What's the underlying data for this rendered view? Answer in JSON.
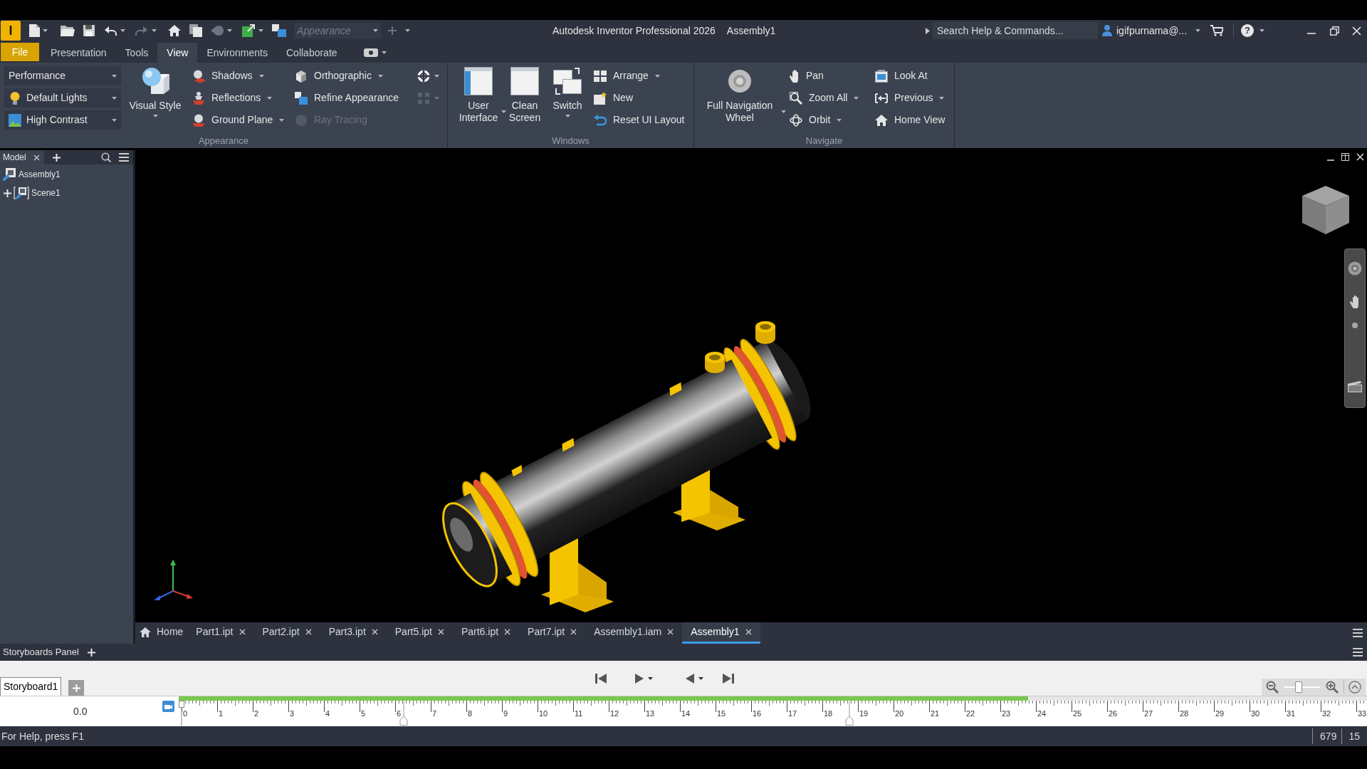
{
  "title_bar": {
    "app_logo": "I",
    "appearance_dropdown": {
      "value": "Appearance",
      "disabled": true
    },
    "title": "Autodesk Inventor Professional 2026",
    "document": "Assembly1",
    "search": {
      "placeholder": "Search Help & Commands..."
    },
    "user": "igifpurnama@...",
    "help_button": "?"
  },
  "ribbon": {
    "file_tab": "File",
    "tabs": [
      {
        "label": "Presentation",
        "selected": false
      },
      {
        "label": "Tools",
        "selected": false
      },
      {
        "label": "View",
        "selected": true
      },
      {
        "label": "Environments",
        "selected": false
      },
      {
        "label": "Collaborate",
        "selected": false
      }
    ],
    "panels": [
      {
        "title": "Appearance",
        "groups": [
          {
            "kind": "dropdowns",
            "items": [
              {
                "value": "Performance"
              },
              {
                "value": "Default Lights"
              },
              {
                "value": "High Contrast"
              }
            ]
          },
          {
            "kind": "large",
            "items": [
              {
                "label": "Visual Style",
                "has_menu": true
              }
            ]
          },
          {
            "kind": "small",
            "items": [
              {
                "label": "Shadows",
                "has_menu": true,
                "disabled": false
              },
              {
                "label": "Reflections",
                "has_menu": true,
                "disabled": false
              },
              {
                "label": "Ground Plane",
                "has_menu": true,
                "disabled": false
              }
            ]
          },
          {
            "kind": "small",
            "items": [
              {
                "label": "Orthographic",
                "has_menu": true,
                "disabled": false
              },
              {
                "label": "Refine Appearance",
                "has_menu": false,
                "disabled": false
              },
              {
                "label": "Ray Tracing",
                "has_menu": false,
                "disabled": true
              }
            ]
          },
          {
            "kind": "icons",
            "items": [
              {
                "has_menu": true,
                "disabled": false
              },
              {
                "has_menu": true,
                "disabled": true
              }
            ]
          }
        ]
      },
      {
        "title": "Windows",
        "groups": [
          {
            "kind": "large",
            "items": [
              {
                "label": "User Interface",
                "has_menu": true
              },
              {
                "label": "Clean Screen",
                "has_menu": false
              },
              {
                "label": "Switch",
                "has_menu": true
              }
            ]
          },
          {
            "kind": "small",
            "items": [
              {
                "label": "Arrange",
                "has_menu": true,
                "disabled": false
              },
              {
                "label": "New",
                "has_menu": false,
                "disabled": false
              },
              {
                "label": "Reset UI Layout",
                "has_menu": false,
                "disabled": false
              }
            ]
          }
        ]
      },
      {
        "title": "Navigate",
        "groups": [
          {
            "kind": "large",
            "items": [
              {
                "label": "Full Navigation Wheel",
                "has_menu": true
              }
            ]
          },
          {
            "kind": "small",
            "items": [
              {
                "label": "Pan",
                "has_menu": false,
                "disabled": false
              },
              {
                "label": "Zoom All",
                "has_menu": true,
                "disabled": false
              },
              {
                "label": "Orbit",
                "has_menu": true,
                "disabled": false
              }
            ]
          },
          {
            "kind": "small",
            "items": [
              {
                "label": "Look At",
                "has_menu": false,
                "disabled": false
              },
              {
                "label": "Previous",
                "has_menu": true,
                "disabled": false
              },
              {
                "label": "Home View",
                "has_menu": false,
                "disabled": false
              }
            ]
          }
        ]
      }
    ]
  },
  "browser": {
    "tabs": [
      {
        "label": "Model",
        "selected": true
      }
    ],
    "tree": {
      "label": "Assembly1",
      "children": [
        {
          "label": "Scene1",
          "expanded": false
        }
      ]
    }
  },
  "document_tabs": [
    {
      "kind": "home",
      "label": "Home",
      "selected": false
    },
    {
      "kind": "document",
      "label": "Part1.ipt",
      "selected": false
    },
    {
      "kind": "document",
      "label": "Part2.ipt",
      "selected": false
    },
    {
      "kind": "document",
      "label": "Part3.ipt",
      "selected": false
    },
    {
      "kind": "document",
      "label": "Part5.ipt",
      "selected": false
    },
    {
      "kind": "document",
      "label": "Part6.ipt",
      "selected": false
    },
    {
      "kind": "document",
      "label": "Part7.ipt",
      "selected": false
    },
    {
      "kind": "document",
      "label": "Assembly1.iam",
      "selected": false
    },
    {
      "kind": "document",
      "label": "Assembly1",
      "selected": true
    }
  ],
  "storyboard_panel": {
    "title": "Storyboards Panel",
    "storyboards": [
      {
        "label": "Storyboard1",
        "selected": true
      }
    ],
    "current_time": "0.0",
    "timeline": {
      "level": 0.715,
      "ticks": [
        "0",
        "1",
        "2",
        "3",
        "4",
        "5",
        "6",
        "7",
        "8",
        "9",
        "10",
        "11",
        "12",
        "13",
        "14",
        "15",
        "16",
        "17",
        "18",
        "19",
        "20",
        "21",
        "22",
        "23",
        "24",
        "25",
        "26",
        "27",
        "28",
        "29",
        "30",
        "31",
        "32",
        "33"
      ]
    },
    "zoom_slider": {
      "level": 0.4
    }
  },
  "status_bar": {
    "help": "For Help, press F1",
    "fields": [
      "679",
      "15"
    ]
  }
}
